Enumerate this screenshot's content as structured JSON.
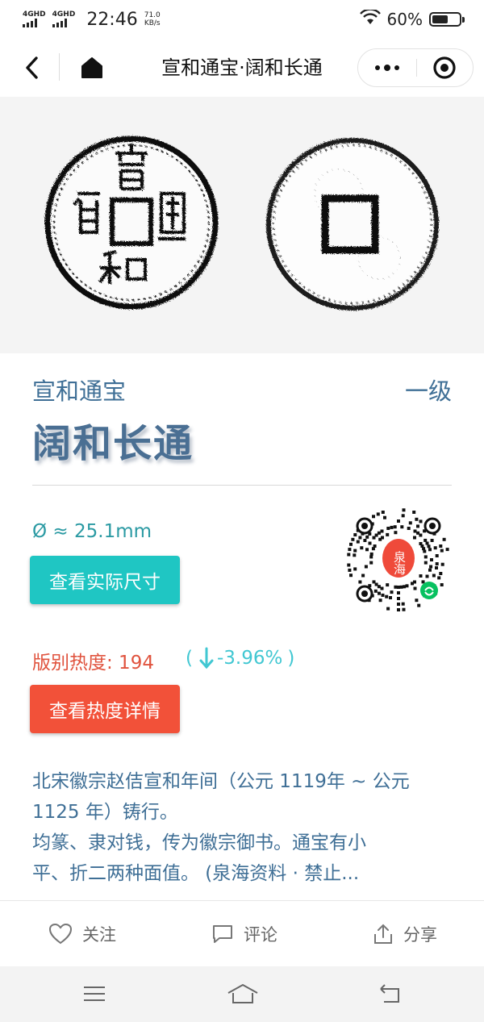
{
  "status": {
    "sim1": "4GHD",
    "sim2": "4GHD",
    "time": "22:46",
    "speed_value": "71.0",
    "speed_unit": "KB/s",
    "battery": "60%",
    "battery_level": 0.6
  },
  "nav": {
    "title": "宣和通宝·阔和长通",
    "back_icon": "chevron-left-icon",
    "home_icon": "home-icon",
    "more_icon": "more-dots-icon",
    "close_icon": "target-circle-icon"
  },
  "coin": {
    "obverse_icon": "coin-obverse-image",
    "reverse_icon": "coin-reverse-image"
  },
  "detail": {
    "dynasty": "宣和通宝",
    "grade": "一级",
    "variety": "阔和长通",
    "diameter": "Ø ≈ 25.1mm",
    "size_button": "查看实际尺寸",
    "heat_label": "版别热度: 194",
    "trend_open": "(",
    "trend_value": "-3.96%",
    "trend_close": ")",
    "trend_icon": "arrow-down-icon",
    "heat_button": "查看热度详情",
    "qr_icon": "miniprogram-qr-code",
    "qr_seal": "泉海",
    "desc_line1": "北宋徽宗赵佶宣和年间（公元 1119年 ~ 公元",
    "desc_line2": "1125 年）铸行。",
    "desc_line3": "均篆、隶对钱，传为徽宗御书。通宝有小",
    "desc_line4": "平、折二两种面值。 (泉海资料 · 禁止..."
  },
  "actions": {
    "follow": "关注",
    "comment": "评论",
    "share": "分享"
  },
  "colors": {
    "dynasty_blue": "#3f6f96",
    "teal_button": "#1fc6c3",
    "red_button": "#f25139",
    "heat_red": "#e0533e",
    "trend_cyan": "#41c7d2"
  }
}
